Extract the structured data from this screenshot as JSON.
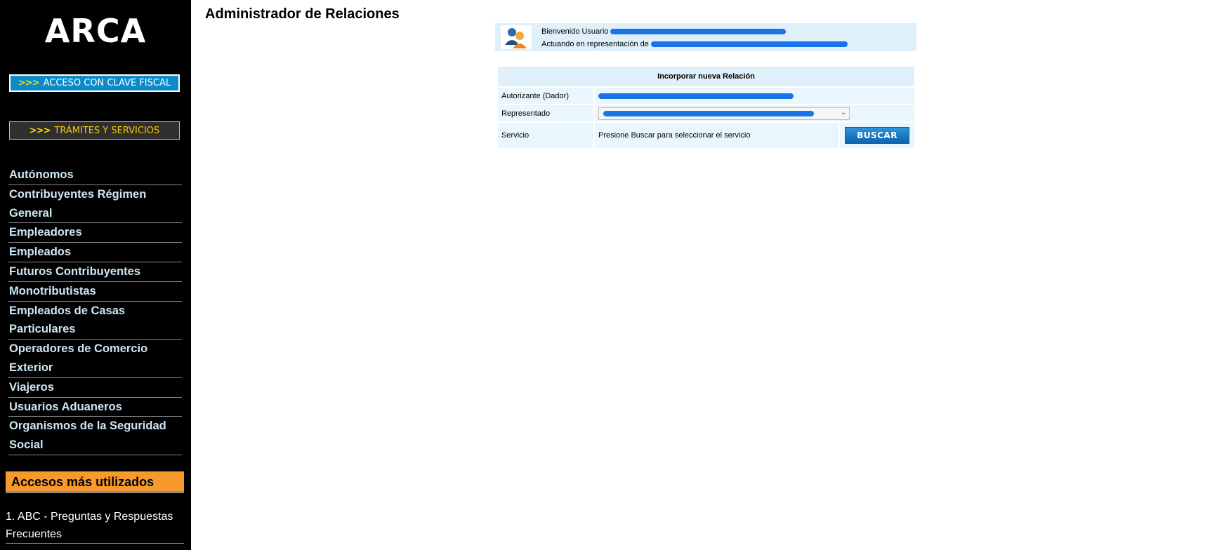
{
  "sidebar": {
    "logo": "ARCA",
    "acceso_arrows": ">>>",
    "acceso_label": "ACCESO CON CLAVE FISCAL",
    "tramites_arrows": ">>>",
    "tramites_label": "TRÁMITES Y SERVICIOS",
    "nav": [
      "Autónomos",
      "Contribuyentes Régimen General",
      "Empleadores",
      "Empleados",
      "Futuros Contribuyentes",
      "Monotributistas",
      "Empleados de Casas Particulares",
      "Operadores de Comercio Exterior",
      "Viajeros",
      "Usuarios Aduaneros",
      "Organismos de la Seguridad Social"
    ],
    "accesos_title": "Accesos más utilizados",
    "accesos": [
      "1. ABC - Preguntas y Respuestas Frecuentes"
    ]
  },
  "main": {
    "title": "Administrador de Relaciones",
    "welcome_line1": "Bienvenido Usuario",
    "welcome_line2": "Actuando en representación de",
    "section_title": "Incorporar nueva Relación",
    "autorizante_label": "Autorizante (Dador)",
    "representado_label": "Representado",
    "servicio_label": "Servicio",
    "servicio_text": "Presione Buscar para seleccionar el servicio",
    "buscar_label": "BUSCAR"
  },
  "colors": {
    "sidebar_bg": "#000000",
    "accent_blue": "#0d8bc6",
    "accesos_orange": "#f79a2e",
    "panel_bg": "#dff0fb",
    "redaction": "#1a73e8"
  }
}
